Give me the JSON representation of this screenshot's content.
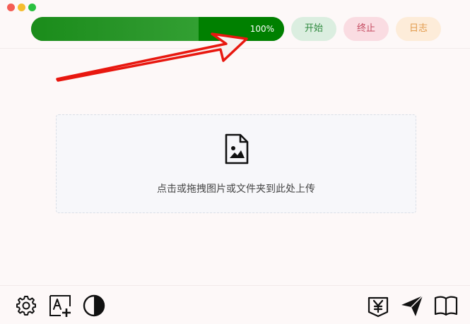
{
  "window": {
    "controls": [
      "close",
      "minimize",
      "maximize"
    ]
  },
  "toolbar": {
    "progress_text": "100%",
    "progress_value": 1.0,
    "start_label": "开始",
    "stop_label": "终止",
    "log_label": "日志"
  },
  "dropzone": {
    "icon": "image-file-icon",
    "text": "点击或拖拽图片或文件夹到此处上传"
  },
  "footer": {
    "left_icons": [
      "gear-icon",
      "font-add-icon",
      "contrast-icon"
    ],
    "right_icons": [
      "yuan-donate-icon",
      "send-icon",
      "book-icon"
    ]
  },
  "colors": {
    "progress": "#008000",
    "start_bg": "#dbeee0",
    "stop_bg": "#fadce2",
    "log_bg": "#fdecd9",
    "annotation_arrow": "#e8170f"
  }
}
